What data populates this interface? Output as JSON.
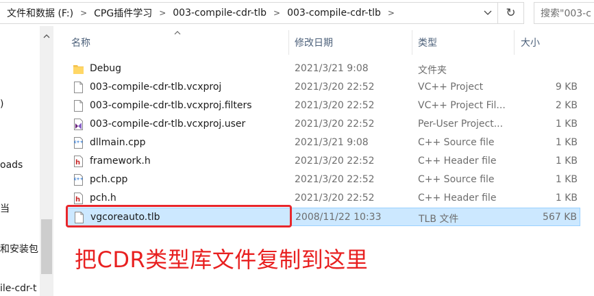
{
  "address": {
    "crumbs": [
      "文件和数据 (F:)",
      "CPG插件学习",
      "003-compile-cdr-tlb",
      "003-compile-cdr-tlb"
    ],
    "separator": ">",
    "dropdown": "⌄",
    "refresh": "↻",
    "search_placeholder": "搜索\"003-c"
  },
  "nav": {
    "items": [
      ")",
      "oads",
      "当",
      "和安装包",
      "",
      "ile-cdr-t"
    ]
  },
  "columns": {
    "name": "名称",
    "date": "修改日期",
    "type": "类型",
    "size": "大小"
  },
  "files": [
    {
      "name": "Debug",
      "date": "2021/3/21 9:08",
      "type": "文件夹",
      "size": "",
      "icon": "folder-icon"
    },
    {
      "name": "003-compile-cdr-tlb.vcxproj",
      "date": "2021/3/20 22:52",
      "type": "VC++ Project",
      "size": "9 KB",
      "icon": "file-icon"
    },
    {
      "name": "003-compile-cdr-tlb.vcxproj.filters",
      "date": "2021/3/20 22:52",
      "type": "VC++ Project Fil...",
      "size": "2 KB",
      "icon": "file-icon"
    },
    {
      "name": "003-compile-cdr-tlb.vcxproj.user",
      "date": "2021/3/20 22:52",
      "type": "Per-User Project...",
      "size": "1 KB",
      "icon": "vs-user-icon"
    },
    {
      "name": "dllmain.cpp",
      "date": "2021/3/21 9:08",
      "type": "C++ Source file",
      "size": "1 KB",
      "icon": "cpp-icon"
    },
    {
      "name": "framework.h",
      "date": "2021/3/20 22:52",
      "type": "C++ Header file",
      "size": "1 KB",
      "icon": "header-icon"
    },
    {
      "name": "pch.cpp",
      "date": "2021/3/20 22:52",
      "type": "C++ Source file",
      "size": "1 KB",
      "icon": "cpp-icon"
    },
    {
      "name": "pch.h",
      "date": "2021/3/20 22:52",
      "type": "C++ Header file",
      "size": "1 KB",
      "icon": "header-icon"
    },
    {
      "name": "vgcoreauto.tlb",
      "date": "2008/11/22 10:33",
      "type": "TLB 文件",
      "size": "567 KB",
      "icon": "file-icon",
      "selected": true
    }
  ],
  "annotation": "把CDR类型库文件复制到这里",
  "colors": {
    "header_text": "#4c607a",
    "selection_bg": "#cce8ff",
    "selection_border": "#99d1ff",
    "annotation_red": "#e82020",
    "folder": "#f5c451"
  }
}
